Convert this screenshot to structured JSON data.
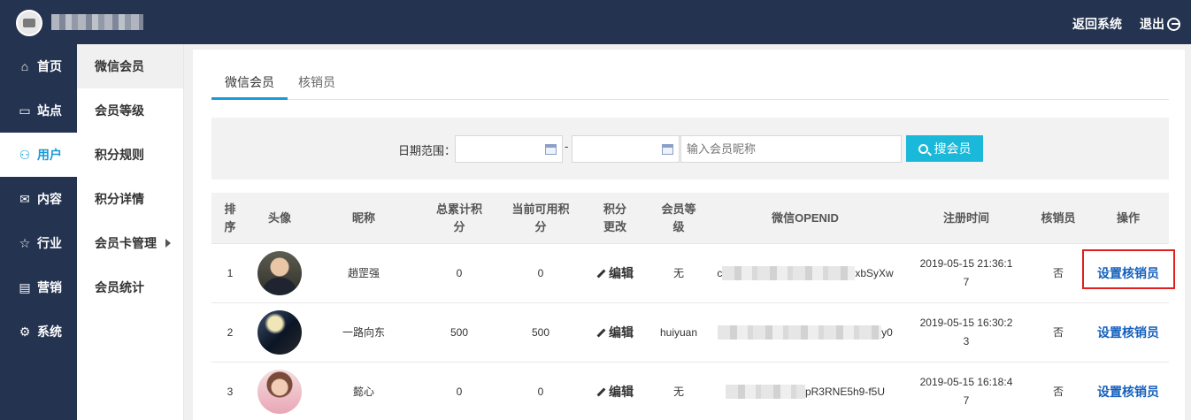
{
  "header": {
    "back_label": "返回系统",
    "logout_label": "退出"
  },
  "sidenav": [
    {
      "icon": "home-icon",
      "glyph": "⌂",
      "label": "首页"
    },
    {
      "icon": "monitor-icon",
      "glyph": "▭",
      "label": "站点"
    },
    {
      "icon": "user-icon",
      "glyph": "⚇",
      "label": "用户",
      "active": true
    },
    {
      "icon": "inbox-icon",
      "glyph": "✉",
      "label": "内容"
    },
    {
      "icon": "star-icon",
      "glyph": "☆",
      "label": "行业"
    },
    {
      "icon": "calendar-icon",
      "glyph": "▤",
      "label": "营销"
    },
    {
      "icon": "gear-icon",
      "glyph": "⚙",
      "label": "系统"
    }
  ],
  "subnav": [
    "微信会员",
    "会员等级",
    "积分规则",
    "积分详情",
    "会员卡管理",
    "会员统计"
  ],
  "tabs": [
    "微信会员",
    "核销员"
  ],
  "search": {
    "date_label": "日期范围：",
    "dash": "-",
    "nick_placeholder": "输入会员昵称",
    "button_label": "搜会员"
  },
  "table": {
    "headers": [
      "排序",
      "头像",
      "昵称",
      "总累计积分",
      "当前可用积分",
      "积分更改",
      "会员等级",
      "微信OPENID",
      "注册时间",
      "核销员",
      "操作"
    ],
    "rows": [
      {
        "index": "1",
        "nickname": "趙罡强",
        "total_points": "0",
        "current_points": "0",
        "edit": "编辑",
        "level": "无",
        "openid_prefix": "c",
        "openid_suffix": "xbSyXw",
        "reg_time": "2019-05-15 21:36:17",
        "verifier": "否",
        "action": "设置核销员"
      },
      {
        "index": "2",
        "nickname": "一路向东",
        "total_points": "500",
        "current_points": "500",
        "edit": "编辑",
        "level": "huiyuan",
        "openid_prefix": "",
        "openid_suffix": "y0",
        "reg_time": "2019-05-15 16:30:23",
        "verifier": "否",
        "action": "设置核销员"
      },
      {
        "index": "3",
        "nickname": "懿心",
        "total_points": "0",
        "current_points": "0",
        "edit": "编辑",
        "level": "无",
        "openid_prefix": "",
        "openid_suffix": "pR3RNE5h9-f5U",
        "reg_time": "2019-05-15 16:18:47",
        "verifier": "否",
        "action": "设置核销员"
      }
    ]
  }
}
